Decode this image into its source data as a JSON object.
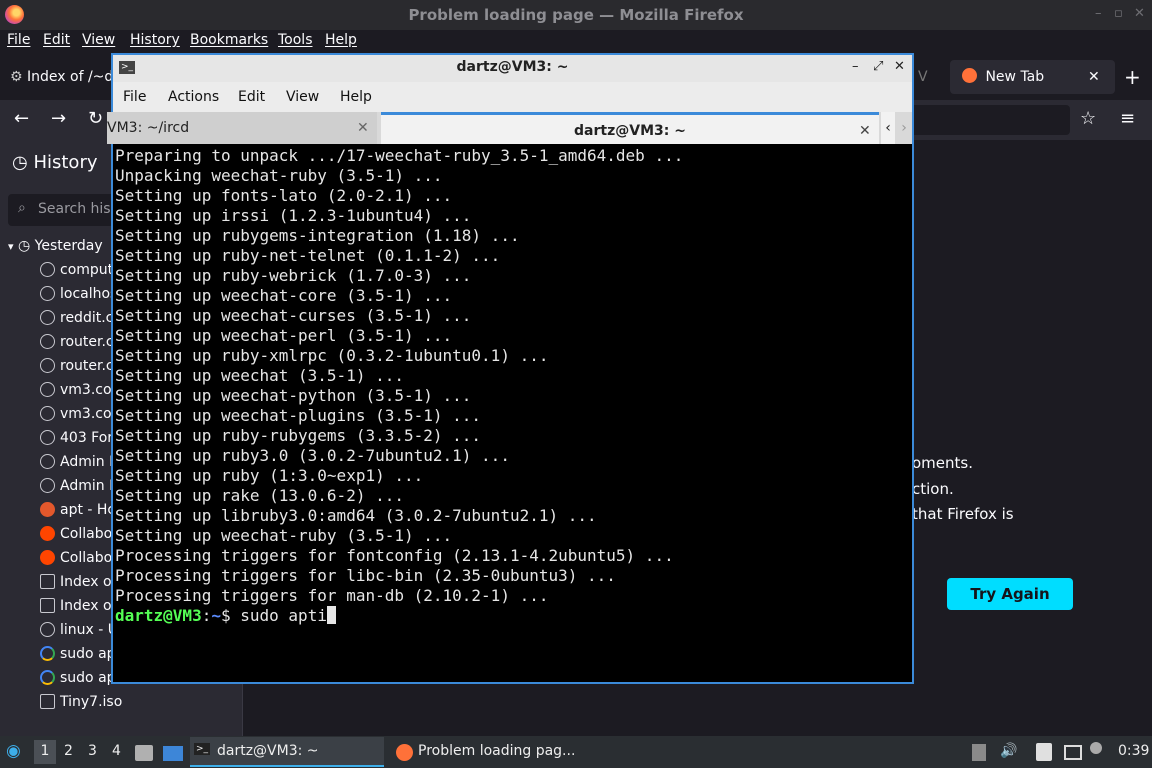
{
  "firefox": {
    "window_title": "Problem loading page — Mozilla Firefox",
    "menu": [
      "File",
      "Edit",
      "View",
      "History",
      "Bookmarks",
      "Tools",
      "Help"
    ],
    "tabs": [
      {
        "label": "Index of /~d"
      },
      {
        "label": "New Tab"
      }
    ],
    "sidebar": {
      "title": "History",
      "search_placeholder": "Search hist",
      "day_label": "Yesterday",
      "items": [
        {
          "label": "comput",
          "icon": "globe-icon"
        },
        {
          "label": "localhos",
          "icon": "globe-icon"
        },
        {
          "label": "reddit.c",
          "icon": "globe-icon"
        },
        {
          "label": "router.c",
          "icon": "globe-icon"
        },
        {
          "label": "router.c",
          "icon": "globe-icon"
        },
        {
          "label": "vm3.co",
          "icon": "globe-icon"
        },
        {
          "label": "vm3.co",
          "icon": "globe-icon"
        },
        {
          "label": "403 For",
          "icon": "globe-icon"
        },
        {
          "label": "Admin F",
          "icon": "globe-icon"
        },
        {
          "label": "Admin F",
          "icon": "globe-icon"
        },
        {
          "label": "apt - Hc",
          "icon": "askubuntu-icon"
        },
        {
          "label": "Collabo",
          "icon": "reddit-icon"
        },
        {
          "label": "Collabo",
          "icon": "reddit-icon"
        },
        {
          "label": "Index of",
          "icon": "file-icon"
        },
        {
          "label": "Index of",
          "icon": "file-icon"
        },
        {
          "label": "linux - U",
          "icon": "globe-icon"
        },
        {
          "label": "sudo ap",
          "icon": "google-icon"
        },
        {
          "label": "sudo ap",
          "icon": "google-icon"
        },
        {
          "label": "Tiny7.iso",
          "icon": "file-icon"
        }
      ]
    },
    "content": {
      "lines": [
        "oments.",
        "ction.",
        "that Firefox is"
      ],
      "try_again": "Try Again"
    }
  },
  "terminal": {
    "window_title": "dartz@VM3: ~",
    "menu": [
      "File",
      "Actions",
      "Edit",
      "View",
      "Help"
    ],
    "tabs": [
      {
        "label": "VM3: ~/ircd"
      },
      {
        "label": "dartz@VM3: ~"
      }
    ],
    "output": [
      "Preparing to unpack .../17-weechat-ruby_3.5-1_amd64.deb ...",
      "Unpacking weechat-ruby (3.5-1) ...",
      "Setting up fonts-lato (2.0-2.1) ...",
      "Setting up irssi (1.2.3-1ubuntu4) ...",
      "Setting up rubygems-integration (1.18) ...",
      "Setting up ruby-net-telnet (0.1.1-2) ...",
      "Setting up ruby-webrick (1.7.0-3) ...",
      "Setting up weechat-core (3.5-1) ...",
      "Setting up weechat-curses (3.5-1) ...",
      "Setting up weechat-perl (3.5-1) ...",
      "Setting up ruby-xmlrpc (0.3.2-1ubuntu0.1) ...",
      "Setting up weechat (3.5-1) ...",
      "Setting up weechat-python (3.5-1) ...",
      "Setting up weechat-plugins (3.5-1) ...",
      "Setting up ruby-rubygems (3.3.5-2) ...",
      "Setting up ruby3.0 (3.0.2-7ubuntu2.1) ...",
      "Setting up ruby (1:3.0~exp1) ...",
      "Setting up rake (13.0.6-2) ...",
      "Setting up libruby3.0:amd64 (3.0.2-7ubuntu2.1) ...",
      "Setting up weechat-ruby (3.5-1) ...",
      "Processing triggers for fontconfig (2.13.1-4.2ubuntu5) ...",
      "Processing triggers for libc-bin (2.35-0ubuntu3) ...",
      "Processing triggers for man-db (2.10.2-1) ..."
    ],
    "prompt_user": "dartz@VM3",
    "prompt_sep": ":",
    "prompt_path": "~",
    "prompt_symbol": "$",
    "command": " sudo apti"
  },
  "taskbar": {
    "workspaces": [
      "1",
      "2",
      "3",
      "4"
    ],
    "windows": [
      {
        "label": "dartz@VM3: ~"
      },
      {
        "label": "Problem loading pag..."
      }
    ],
    "clock": "0:39"
  }
}
